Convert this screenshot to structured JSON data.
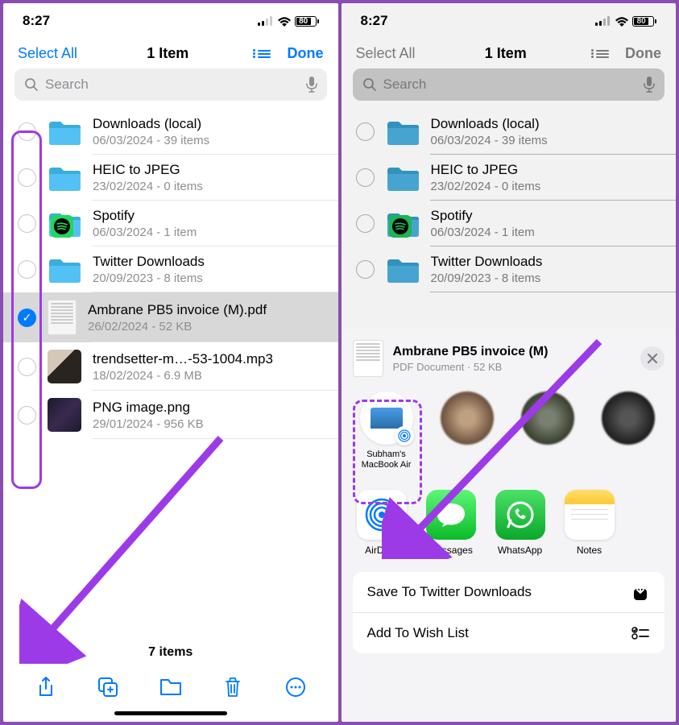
{
  "status": {
    "time": "8:27",
    "battery": "80"
  },
  "toolbar": {
    "select_all": "Select All",
    "title": "1 Item",
    "done": "Done"
  },
  "search": {
    "placeholder": "Search"
  },
  "files": [
    {
      "name": "Downloads (local)",
      "meta": "06/03/2024 - 39 items",
      "type": "folder",
      "selected": false
    },
    {
      "name": "HEIC to JPEG",
      "meta": "23/02/2024 - 0 items",
      "type": "folder",
      "selected": false
    },
    {
      "name": "Spotify",
      "meta": "06/03/2024 - 1 item",
      "type": "spotify",
      "selected": false
    },
    {
      "name": "Twitter Downloads",
      "meta": "20/09/2023 - 8 items",
      "type": "folder",
      "selected": false
    },
    {
      "name": "Ambrane PB5 invoice (M).pdf",
      "meta": "26/02/2024 - 52 KB",
      "type": "pdf",
      "selected": true
    },
    {
      "name": "trendsetter-m…-53-1004.mp3",
      "meta": "18/02/2024 - 6.9 MB",
      "type": "photo1",
      "selected": false
    },
    {
      "name": "PNG image.png",
      "meta": "29/01/2024 - 956 KB",
      "type": "photo2",
      "selected": false
    }
  ],
  "footer": {
    "count": "7 items"
  },
  "share": {
    "title": "Ambrane PB5 invoice (M)",
    "meta": "PDF Document · 52 KB",
    "airdrop_target": "Subham's\nMacBook Air",
    "apps": [
      {
        "label": "AirDrop"
      },
      {
        "label": "Messages"
      },
      {
        "label": "WhatsApp"
      },
      {
        "label": "Notes"
      }
    ],
    "actions": [
      {
        "label": "Save To Twitter Downloads"
      },
      {
        "label": "Add To Wish List"
      }
    ]
  }
}
